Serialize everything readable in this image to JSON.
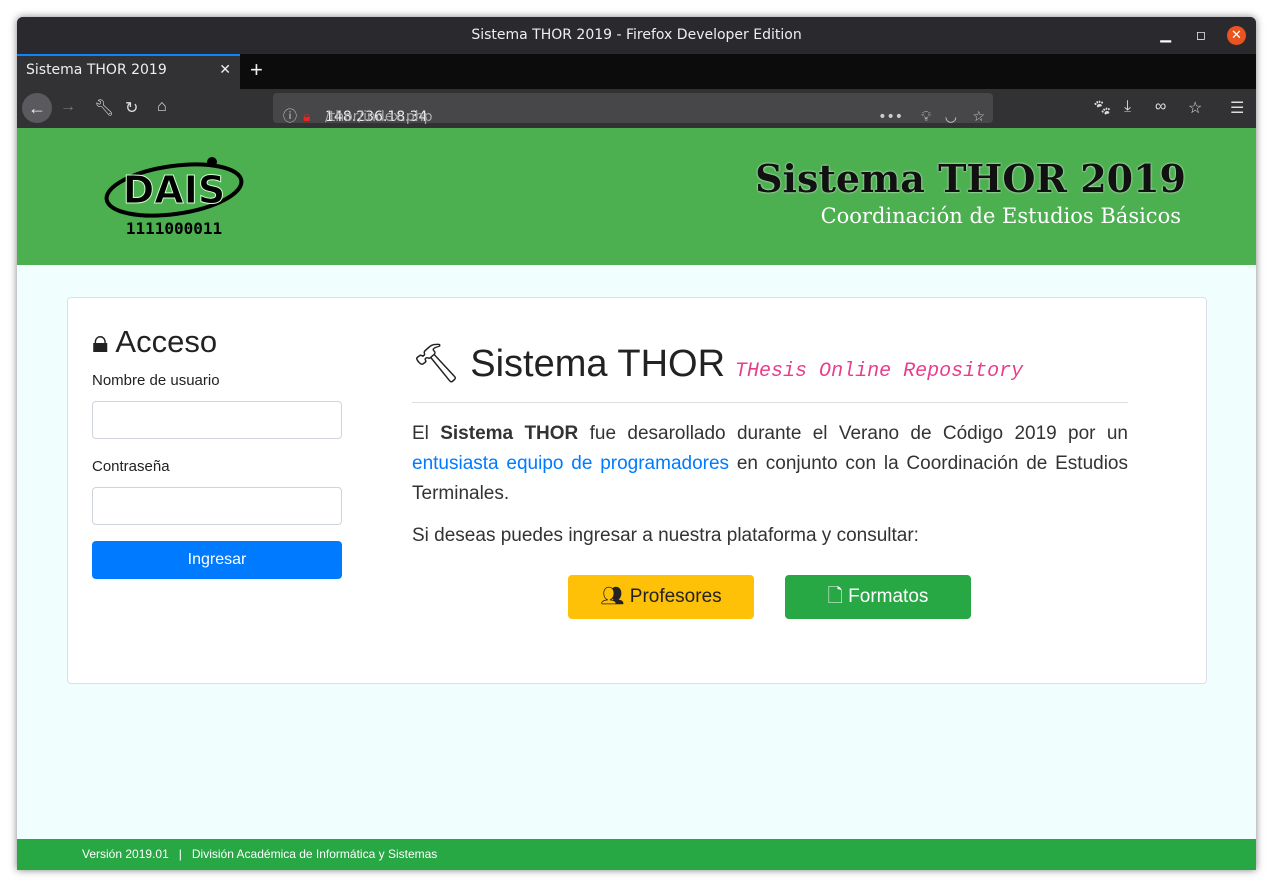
{
  "window": {
    "title": "Sistema THOR 2019 - Firefox Developer Edition"
  },
  "tab": {
    "label": "Sistema THOR 2019"
  },
  "url": {
    "host": "148.236.18.34",
    "path": "/thor/index.php"
  },
  "header": {
    "logo_text": "DAIS",
    "logo_binary": "1111000011",
    "title": "Sistema THOR 2019",
    "subtitle": "Coordinación de Estudios Básicos"
  },
  "login": {
    "title": "Acceso",
    "username_label": "Nombre de usuario",
    "username_value": "",
    "password_label": "Contraseña",
    "password_value": "",
    "submit": "Ingresar"
  },
  "main": {
    "title": "Sistema THOR",
    "tagline": "THesis Online Repository",
    "p1_a": "El ",
    "p1_bold": "Sistema THOR",
    "p1_b": " fue desarollado durante el Verano de Código 2019 por un ",
    "p1_link": "entusiasta equipo de programadores",
    "p1_c": " en conjunto con la Coordinación de Estudios Terminales.",
    "p2": "Si deseas puedes ingresar a nuestra plataforma y consultar:",
    "btn_profesores": "Profesores",
    "btn_formatos": "Formatos"
  },
  "footer": {
    "text": "Versión 2019.01   |   División Académica de Informática y Sistemas"
  }
}
